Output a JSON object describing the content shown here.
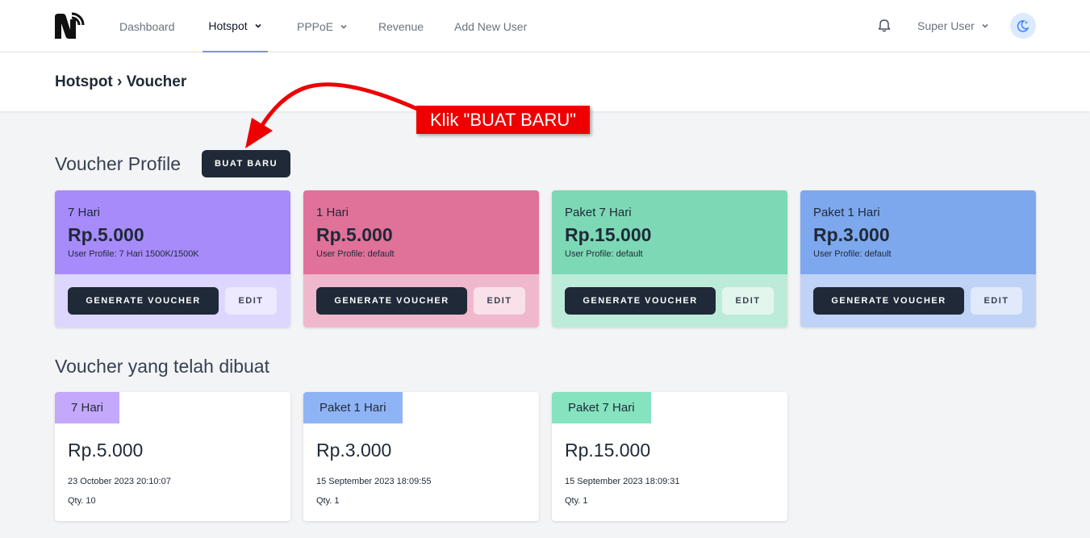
{
  "nav": {
    "items": [
      {
        "label": "Dashboard"
      },
      {
        "label": "Hotspot"
      },
      {
        "label": "PPPoE"
      },
      {
        "label": "Revenue"
      },
      {
        "label": "Add New User"
      }
    ],
    "user": "Super User",
    "icons": {
      "logo": "brand-logo",
      "bell": "bell-icon",
      "theme": "moon-stars-icon"
    }
  },
  "breadcrumb": "Hotspot › Voucher",
  "annotation": "Klik \"BUAT BARU\"",
  "profiles_section": {
    "title": "Voucher Profile",
    "create_label": "BUAT BARU",
    "cards": [
      {
        "name": "7 Hari",
        "price": "Rp.5.000",
        "user_profile": "User Profile: 7 Hari 1500K/1500K",
        "generate": "GENERATE VOUCHER",
        "edit": "EDIT",
        "color_top": "#a78bfa",
        "color_bottom": "#ddd6fe",
        "edit_bg": "#ede9fe"
      },
      {
        "name": "1 Hari",
        "price": "Rp.5.000",
        "user_profile": "User Profile: default",
        "generate": "GENERATE VOUCHER",
        "edit": "EDIT",
        "color_top": "#e07199",
        "color_bottom": "#f0b8cc",
        "edit_bg": "#f9e0e9"
      },
      {
        "name": "Paket 7 Hari",
        "price": "Rp.15.000",
        "user_profile": "User Profile: default",
        "generate": "GENERATE VOUCHER",
        "edit": "EDIT",
        "color_top": "#7dd8b5",
        "color_bottom": "#bdebd9",
        "edit_bg": "#e2f6ee"
      },
      {
        "name": "Paket 1 Hari",
        "price": "Rp.3.000",
        "user_profile": "User Profile: default",
        "generate": "GENERATE VOUCHER",
        "edit": "EDIT",
        "color_top": "#7ea8ed",
        "color_bottom": "#bfd3f6",
        "edit_bg": "#e1eafb"
      }
    ]
  },
  "vouchers_section": {
    "title": "Voucher yang telah dibuat",
    "cards": [
      {
        "tag": "7 Hari",
        "price": "Rp.5.000",
        "date": "23 October 2023 20:10:07",
        "qty": "Qty. 10",
        "tag_color": "#c4a8fb"
      },
      {
        "tag": "Paket 1 Hari",
        "price": "Rp.3.000",
        "date": "15 September 2023 18:09:55",
        "qty": "Qty. 1",
        "tag_color": "#8fb4f5"
      },
      {
        "tag": "Paket 7 Hari",
        "price": "Rp.15.000",
        "date": "15 September 2023 18:09:31",
        "qty": "Qty. 1",
        "tag_color": "#86e3c0"
      }
    ]
  }
}
